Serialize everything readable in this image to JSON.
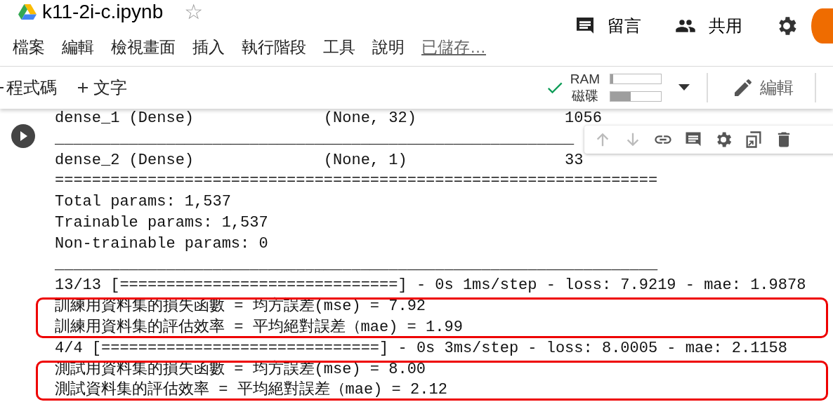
{
  "header": {
    "title": "k11-2i-c.ipynb",
    "star": "☆",
    "comment_label": "留言",
    "share_label": "共用"
  },
  "menu": {
    "items": [
      "檔案",
      "編輯",
      "檢視畫面",
      "插入",
      "執行階段",
      "工具",
      "說明"
    ],
    "save_status": "已儲存…"
  },
  "toolbar": {
    "add_code": "程式碼",
    "add_text": "文字",
    "connected": true,
    "meters": [
      {
        "label": "RAM",
        "level": 0.05
      },
      {
        "label": "磁碟",
        "level": 0.4
      }
    ],
    "edit_label": "編輯"
  },
  "cell_toolbar": {
    "buttons": [
      {
        "kind": "up",
        "disabled": true
      },
      {
        "kind": "down",
        "disabled": true
      },
      {
        "kind": "link",
        "disabled": false
      },
      {
        "kind": "comment",
        "disabled": false
      },
      {
        "kind": "settings",
        "disabled": false
      },
      {
        "kind": "mirror",
        "disabled": false
      },
      {
        "kind": "delete",
        "disabled": false
      }
    ]
  },
  "output": [
    {
      "highlighted": false,
      "lines": [
        "dense_1 (Dense)              (None, 32)                1056",
        "________________________________________________________",
        "dense_2 (Dense)              (None, 1)                 33",
        "=================================================================",
        "Total params: 1,537",
        "Trainable params: 1,537",
        "Non-trainable params: 0",
        "_________________________________________________________________",
        "13/13 [==============================] - 0s 1ms/step - loss: 7.9219 - mae: 1.9878"
      ]
    },
    {
      "highlighted": true,
      "lines": [
        "訓練用資料集的損失函數 = 均方誤差(mse) = 7.92",
        "訓練用資料集的評估效率 = 平均絕對誤差（mae) = 1.99"
      ]
    },
    {
      "highlighted": false,
      "lines": [
        "4/4 [==============================] - 0s 3ms/step - loss: 8.0005 - mae: 2.1158"
      ]
    },
    {
      "highlighted": true,
      "lines": [
        "測試用資料集的損失函數 = 均方誤差(mse) = 8.00",
        "測試資料集的評估效率 = 平均絕對誤差（mae) = 2.12"
      ]
    }
  ]
}
